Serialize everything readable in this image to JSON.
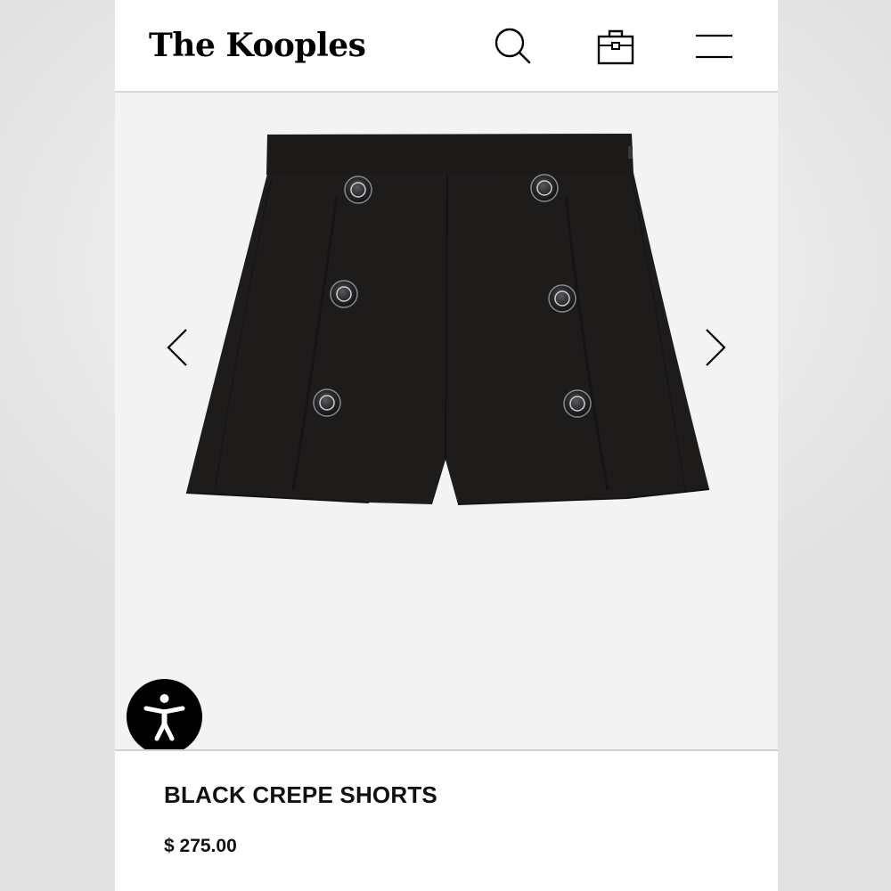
{
  "header": {
    "logo": "The Kooples",
    "icons": [
      "search-icon",
      "shopping-bag-icon",
      "hamburger-menu-icon"
    ]
  },
  "gallery": {
    "image": "black-crepe-shorts-photo",
    "prev_icon": "chevron-left-icon",
    "next_icon": "chevron-right-icon",
    "accessibility_icon": "accessibility-icon"
  },
  "product": {
    "name": "BLACK CREPE SHORTS",
    "price": "$ 275.00"
  },
  "colors": {
    "background": "#f3f3f3",
    "text": "#111111",
    "garment": "#1e1b1b",
    "accessibility_button": "#000000"
  }
}
